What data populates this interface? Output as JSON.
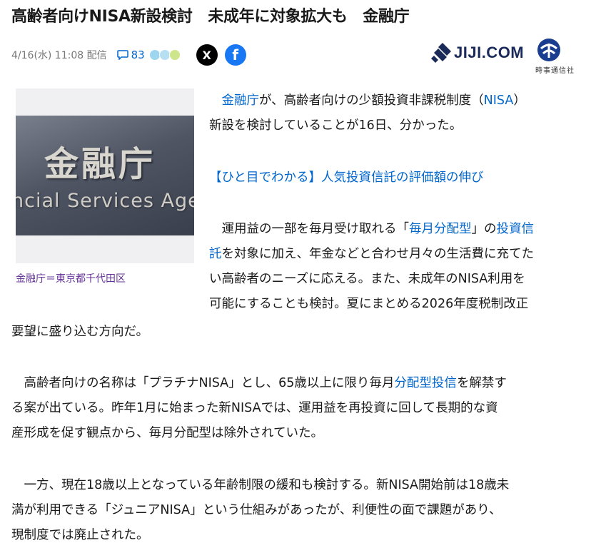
{
  "article": {
    "title": "高齢者向けNISA新設検討　未成年に対象拡大も　金融庁",
    "datetime": "4/16(水) 11:08 配信",
    "comment_count": "83"
  },
  "share": {
    "x_label": "X",
    "facebook_label": "f"
  },
  "source": {
    "logo_text": "JIJI.COM",
    "logo_sub": "時事通信社"
  },
  "photo": {
    "kanji": "金融庁",
    "english": "ncial Services Agency",
    "caption": "金融庁＝東京都千代田区"
  },
  "paragraphs": {
    "p1": {
      "l1_link1": "金融庁",
      "l1_t1": "が、高齢者向けの少額投資非課税制度（",
      "l1_link2": "NISA",
      "l1_t2": "）",
      "l2": "新設を検討していることが16日、分かった。"
    },
    "p2": {
      "link": "【ひと目でわかる】人気投資信託の評価額の伸び"
    },
    "p3": {
      "l1_t1": "運用益の一部を毎月受け取れる「",
      "l1_link1": "毎月分配型",
      "l1_t2": "」の",
      "l1_link2": "投資信",
      "l2_link": "託",
      "l2_t": "を対象に加え、年金などと合わせ月々の生活費に充てた",
      "l3": "い高齢者のニーズに応える。また、未成年のNISA利用を",
      "l4": "可能にすることも検討。夏にまとめる2026年度税制改正",
      "l5": "要望に盛り込む方向だ。"
    },
    "p4": {
      "l1_t": "高齢者向けの名称は「プラチナNISA」とし、65歳以上に限り毎月",
      "l1_link": "分配型投信",
      "l1_t2": "を解禁す",
      "l2": "る案が出ている。昨年1月に始まった新NISAでは、運用益を再投資に回して長期的な資",
      "l3": "産形成を促す観点から、毎月分配型は除外されていた。"
    },
    "p5": {
      "l1": "一方、現在18歳以上となっている年齢制限の緩和も検討する。新NISA開始前は18歳未",
      "l2": "満が利用できる「ジュニアNISA」という仕組みがあったが、利便性の面で課題があり、",
      "l3": "現制度では廃止された。"
    }
  },
  "colors": {
    "link": "#0066cc",
    "caption": "#663399",
    "x": "#000000",
    "facebook": "#1877f2"
  },
  "icons": [
    "comment-icon",
    "reaction-faces-icon",
    "x-share-icon",
    "facebook-share-icon",
    "jiji-logo-icon"
  ]
}
